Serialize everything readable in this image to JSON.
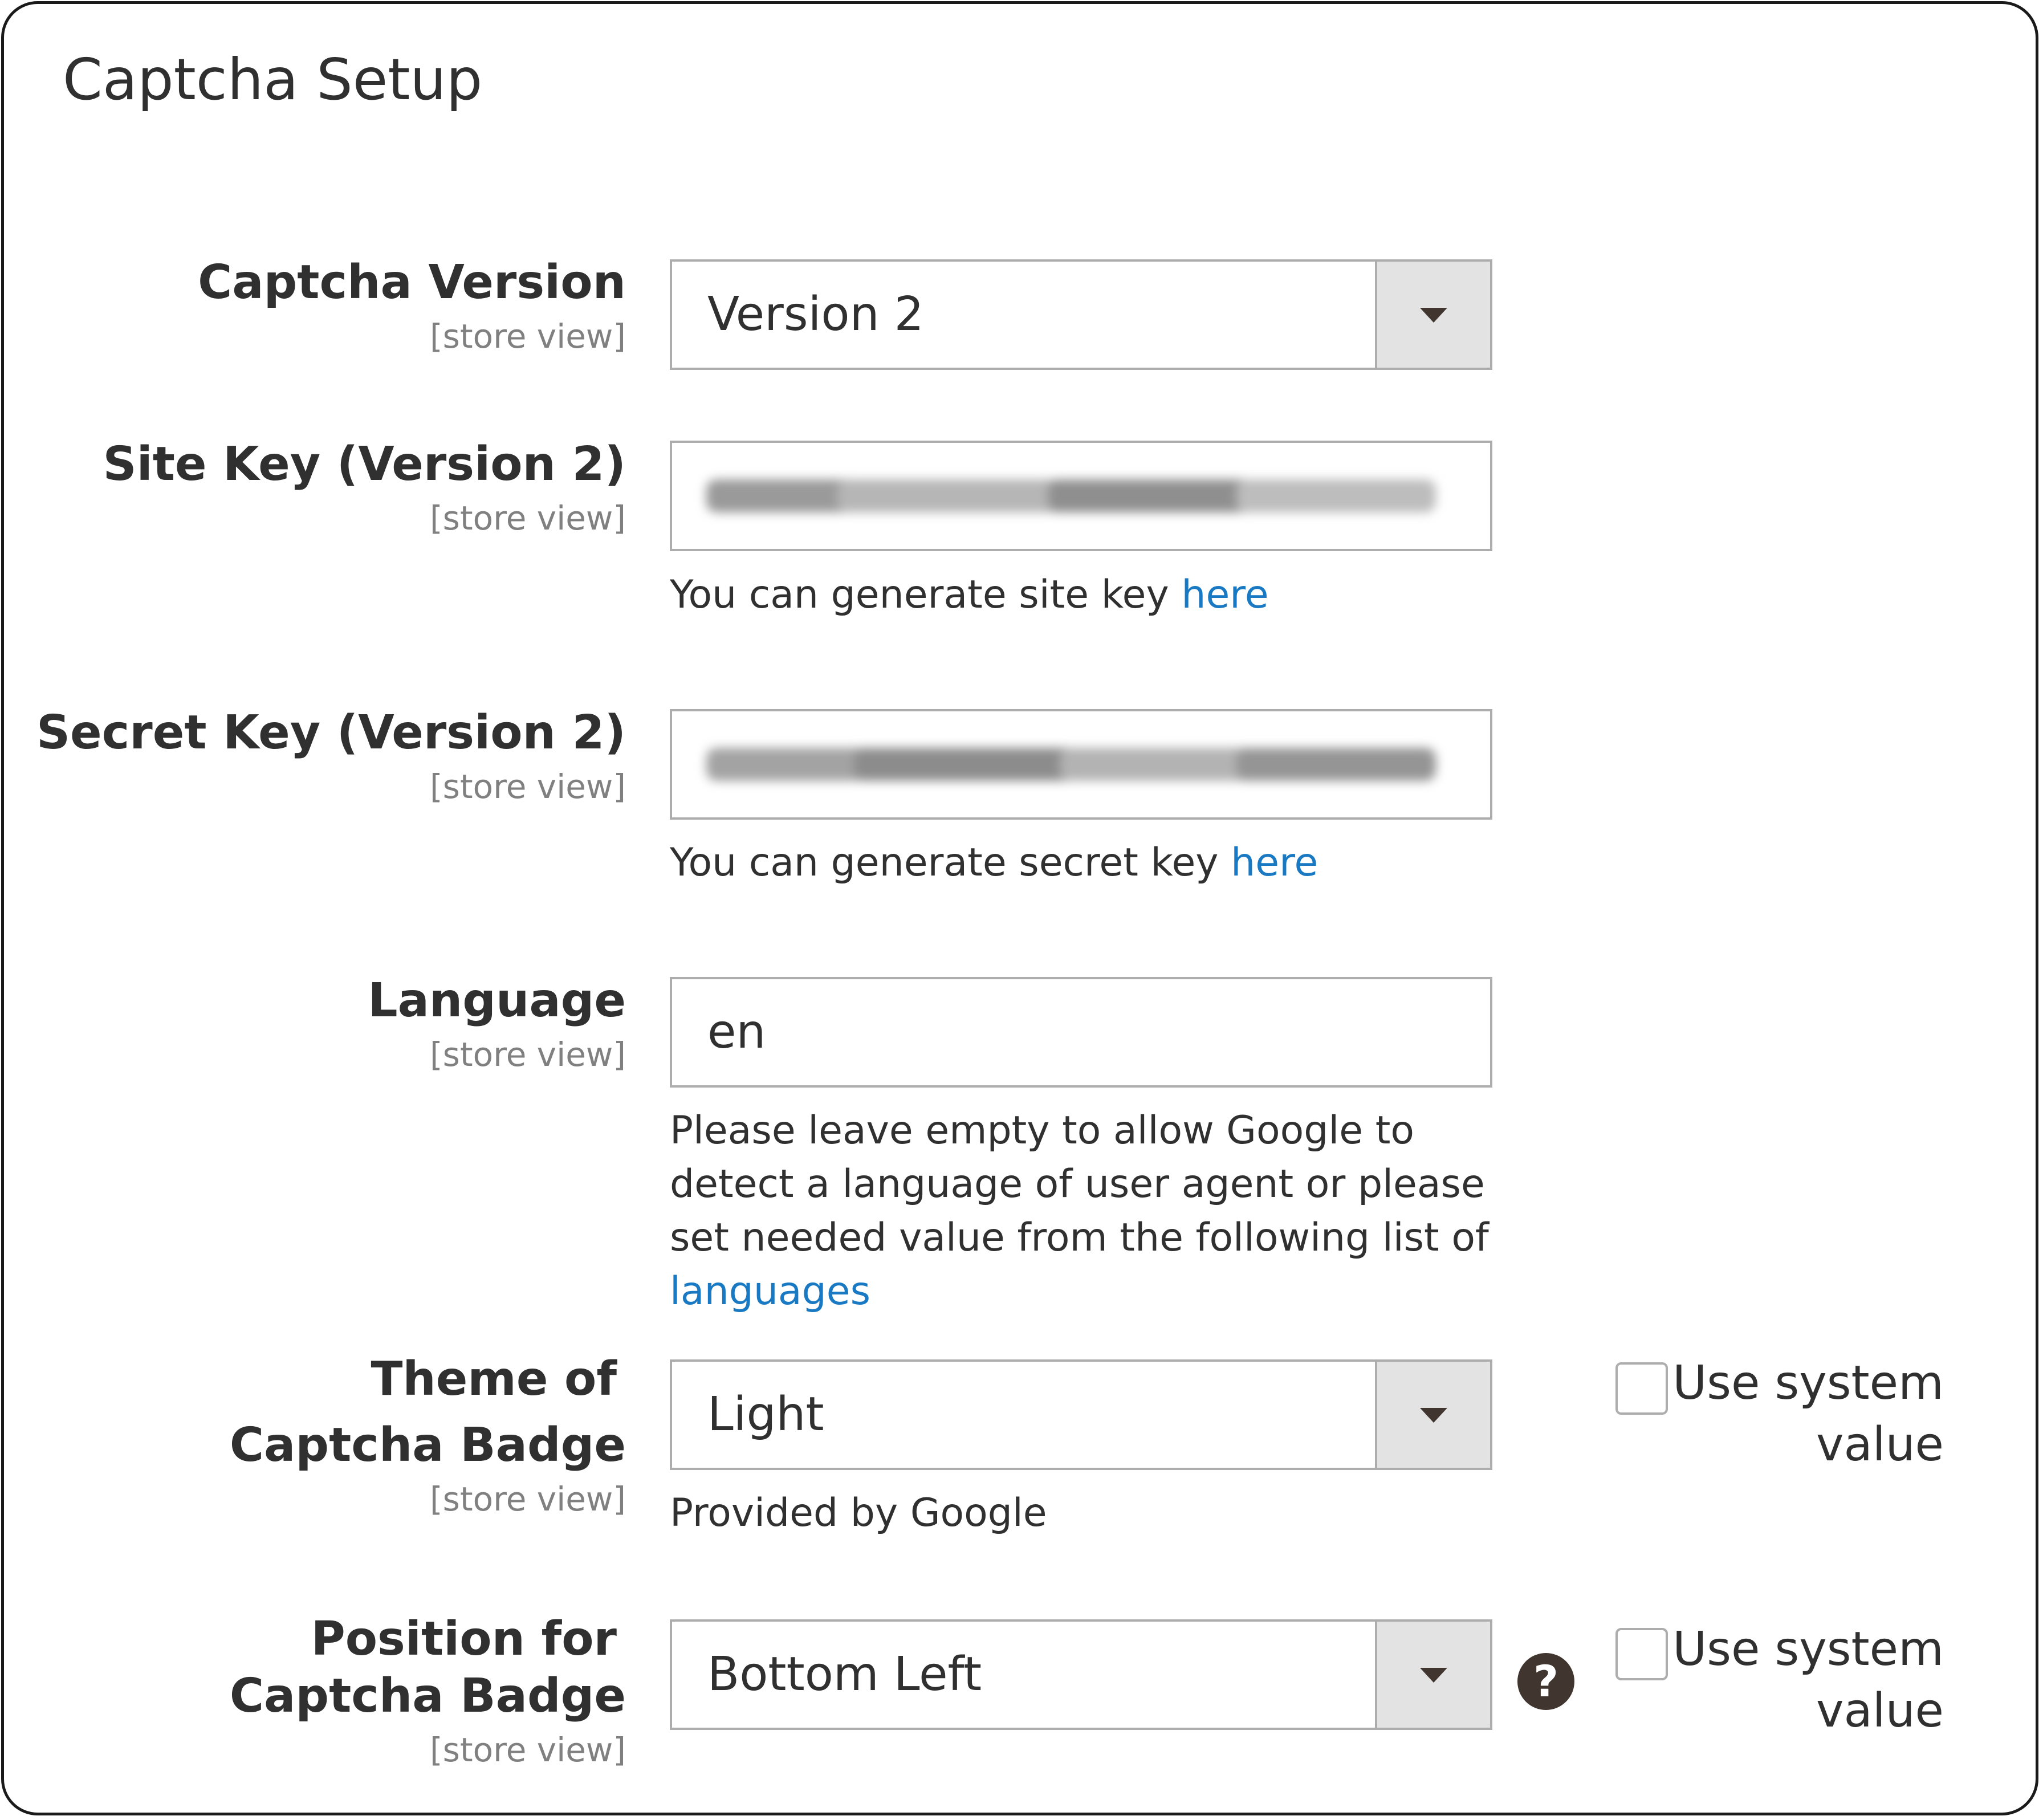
{
  "section": {
    "title": "Captcha Setup"
  },
  "fields": {
    "captcha_version": {
      "label": "Captcha Version",
      "scope": "[store view]",
      "value": "Version 2"
    },
    "site_key": {
      "label": "Site Key (Version 2)",
      "scope": "[store view]",
      "note_text": "You can generate site key ",
      "note_link": "here"
    },
    "secret_key": {
      "label": "Secret Key (Version 2)",
      "scope": "[store view]",
      "note_text": "You can generate secret key ",
      "note_link": "here"
    },
    "language": {
      "label": "Language",
      "scope": "[store view]",
      "value": "en",
      "note_lines": [
        "Please leave empty to allow Google to",
        "detect a language of user agent or please",
        "set needed value from the following list of"
      ],
      "note_link": "languages"
    },
    "theme": {
      "label_line1": "Theme of",
      "label_line2": "Captcha Badge",
      "scope": "[store view]",
      "value": "Light",
      "note": "Provided by Google",
      "use_system_line1": "Use system",
      "use_system_line2": "value",
      "use_system_checked": false
    },
    "position": {
      "label_line1": "Position for",
      "label_line2": "Captcha Badge",
      "scope": "[store view]",
      "value": "Bottom Left",
      "help_glyph": "?",
      "use_system_line1": "Use system",
      "use_system_line2": "value",
      "use_system_checked": false
    }
  },
  "icons": {
    "dropdown": "chevron-down-icon",
    "help": "question-circle-icon"
  },
  "colors": {
    "link": "#1979c3",
    "text": "#303030",
    "scope": "#808080",
    "border": "#adadad",
    "select_button": "#e3e3e3",
    "dark_icon": "#41362f"
  }
}
